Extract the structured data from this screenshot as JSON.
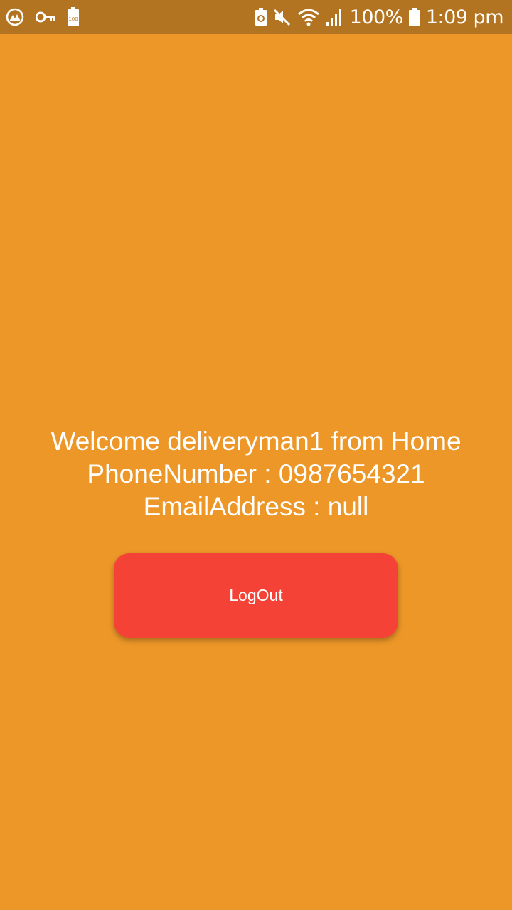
{
  "status_bar": {
    "battery_percent": "100%",
    "time": "1:09 pm",
    "left_icons": [
      "vpn-app-icon",
      "key-icon",
      "battery-saver-100-icon"
    ],
    "right_icons": [
      "battery-info-icon",
      "mute-icon",
      "wifi-icon",
      "signal-icon",
      "battery-icon"
    ]
  },
  "home": {
    "welcome_text": "Welcome deliveryman1 from Home",
    "phone_text": "PhoneNumber : 0987654321",
    "email_text": "EmailAddress : null",
    "logout_label": "LogOut"
  },
  "colors": {
    "background": "#EC9728",
    "status_bar": "#B37421",
    "logout_button": "#F44336",
    "text": "#FFFFFF"
  }
}
